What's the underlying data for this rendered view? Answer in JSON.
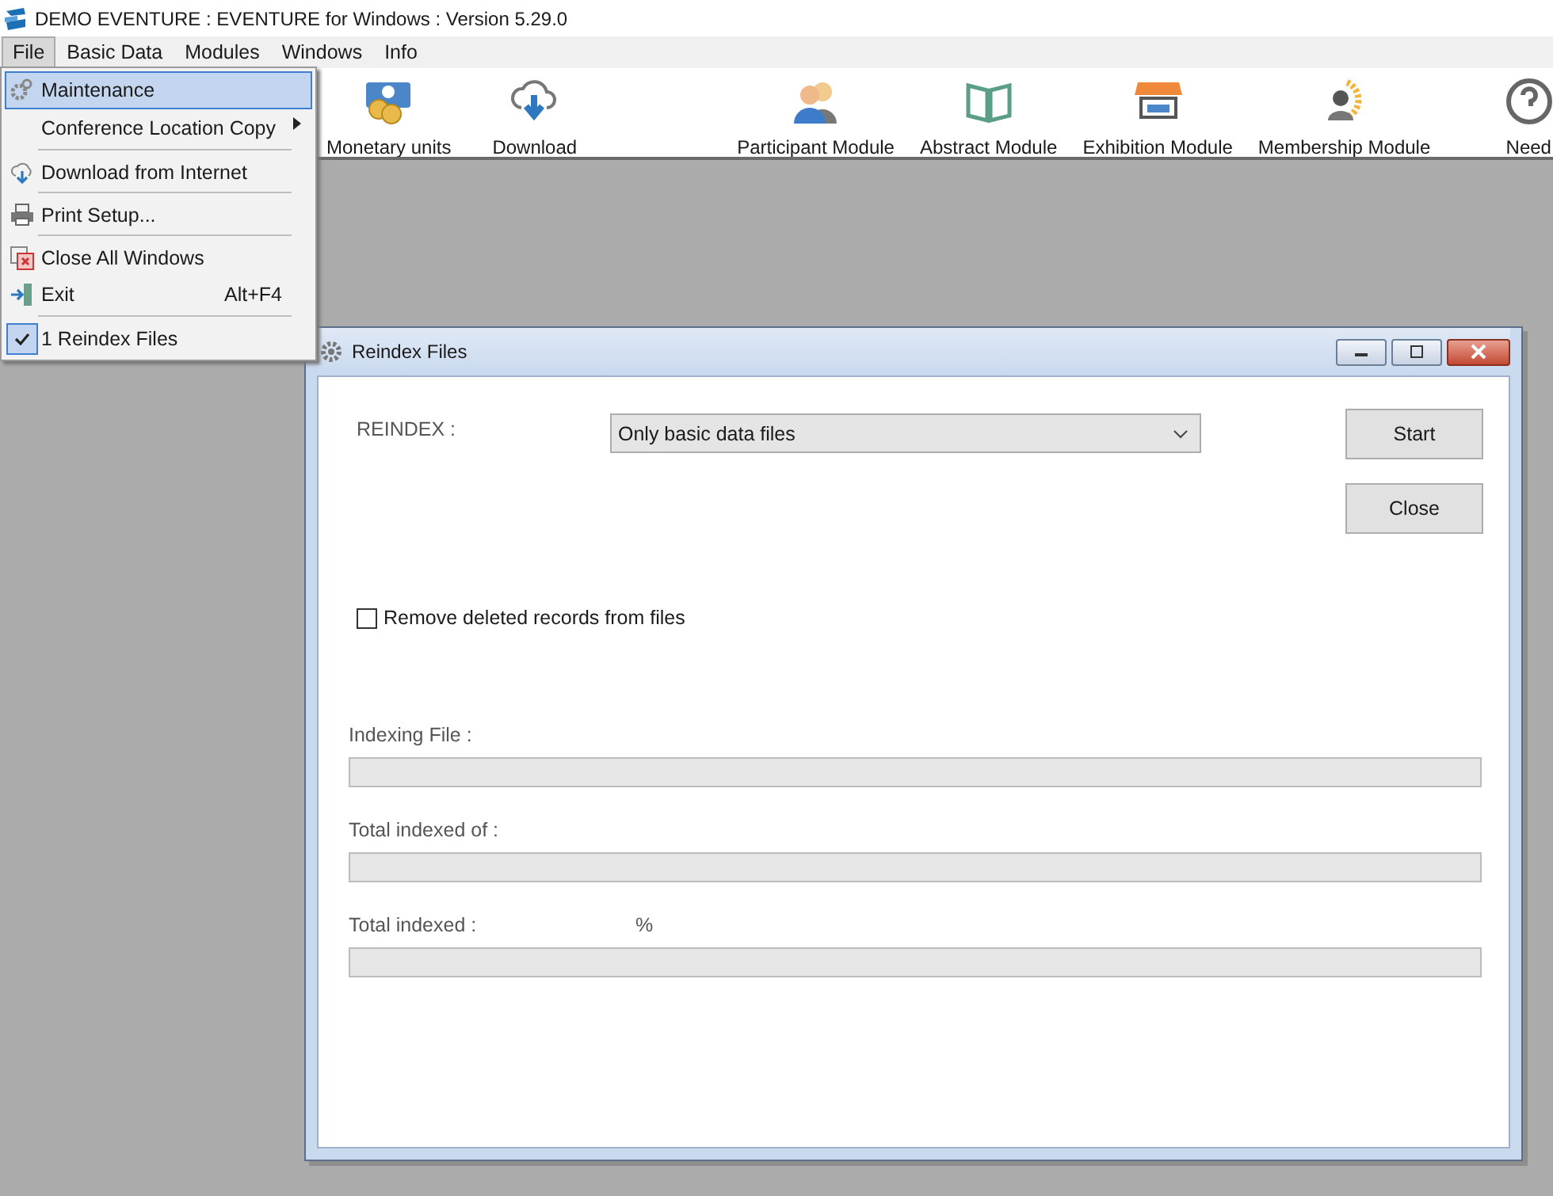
{
  "window": {
    "title": "DEMO EVENTURE : EVENTURE for Windows : Version 5.29.0"
  },
  "menubar": [
    {
      "label": "File",
      "selected": true
    },
    {
      "label": "Basic Data",
      "selected": false
    },
    {
      "label": "Modules",
      "selected": false
    },
    {
      "label": "Windows",
      "selected": false
    },
    {
      "label": "Info",
      "selected": false
    }
  ],
  "file_menu": [
    {
      "label": "Maintenance",
      "selected": true,
      "separator_before": false,
      "submenu": false,
      "checked": false
    },
    {
      "label": "Conference Location Copy",
      "selected": false,
      "separator_before": false,
      "submenu": true,
      "checked": false
    },
    {
      "label": "Download from Internet",
      "selected": false,
      "separator_before": true,
      "submenu": false,
      "checked": false
    },
    {
      "label": "Print Setup...",
      "selected": false,
      "separator_before": true,
      "submenu": false,
      "checked": false
    },
    {
      "label": "Close All Windows",
      "selected": false,
      "separator_before": true,
      "submenu": false,
      "checked": false
    },
    {
      "label": "Exit",
      "shortcut": "Alt+F4",
      "selected": false,
      "separator_before": false,
      "submenu": false,
      "checked": false
    },
    {
      "label": "1 Reindex Files",
      "selected": false,
      "separator_before": true,
      "submenu": false,
      "checked": true
    }
  ],
  "toolbar": [
    {
      "label": "Monetary units"
    },
    {
      "label": "Download"
    },
    {
      "label": "Participant Module"
    },
    {
      "label": "Abstract Module"
    },
    {
      "label": "Exhibition Module"
    },
    {
      "label": "Membership Module"
    },
    {
      "label": "Need"
    }
  ],
  "dialog": {
    "title": "Reindex Files",
    "reindex_label": "REINDEX :",
    "reindex_select": {
      "value": "Only basic data files"
    },
    "buttons": [
      "Start",
      "Close"
    ],
    "remove_deleted": {
      "label": "Remove deleted records from files",
      "checked": false
    },
    "progress": [
      {
        "label": "Indexing File :",
        "level": 0
      },
      {
        "label": "Total indexed  of :",
        "level": 0
      },
      {
        "label": "Total indexed  :",
        "suffix": "%",
        "level": 0
      }
    ]
  }
}
